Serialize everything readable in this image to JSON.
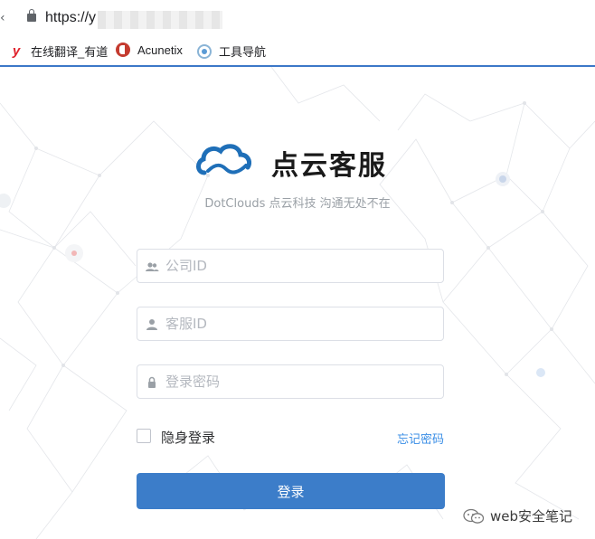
{
  "browser": {
    "url_prefix": "https://y",
    "bookmarks": [
      {
        "label": "在线翻译_有道",
        "icon": "youdao-icon"
      },
      {
        "label": "Acunetix",
        "icon": "acunetix-icon"
      },
      {
        "label": "工具导航",
        "icon": "tools-nav-icon"
      }
    ]
  },
  "login": {
    "brand": "点云客服",
    "slogan": "DotClouds 点云科技 沟通无处不在",
    "company_id_placeholder": "公司ID",
    "agent_id_placeholder": "客服ID",
    "password_placeholder": "登录密码",
    "incognito_label": "隐身登录",
    "forgot_label": "忘记密码",
    "submit_label": "登录"
  },
  "watermark": {
    "text": "web安全笔记"
  },
  "colors": {
    "primary": "#3c7dc9",
    "link": "#3a8ee6",
    "logo_blue": "#1f6fb8"
  }
}
